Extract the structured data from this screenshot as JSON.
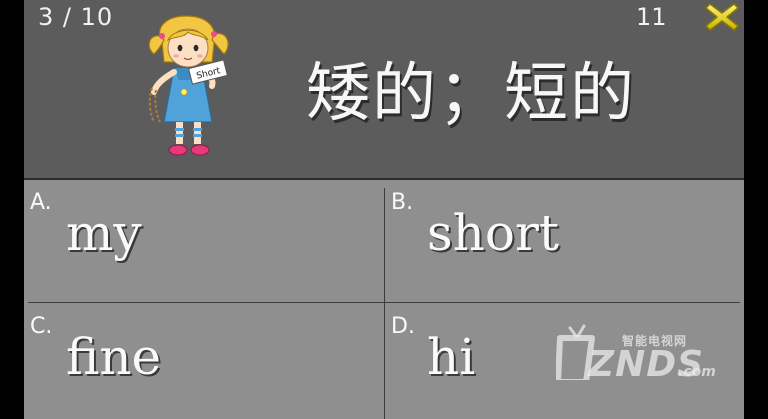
{
  "header": {
    "progress": "3 / 10",
    "timer": "11",
    "prompt": "矮的；短的",
    "sign_text": "Short"
  },
  "answers": [
    {
      "letter": "A.",
      "word": "my"
    },
    {
      "letter": "B.",
      "word": "short"
    },
    {
      "letter": "C.",
      "word": "fine"
    },
    {
      "letter": "D.",
      "word": "hi"
    }
  ],
  "watermark": {
    "brand": "ZNDS",
    "suffix": ".com",
    "subtitle": "智能电视网"
  },
  "colors": {
    "header_bg": "#5c5c5c",
    "answers_bg": "#8f8f8f",
    "close_icon": "#e6d21a"
  }
}
